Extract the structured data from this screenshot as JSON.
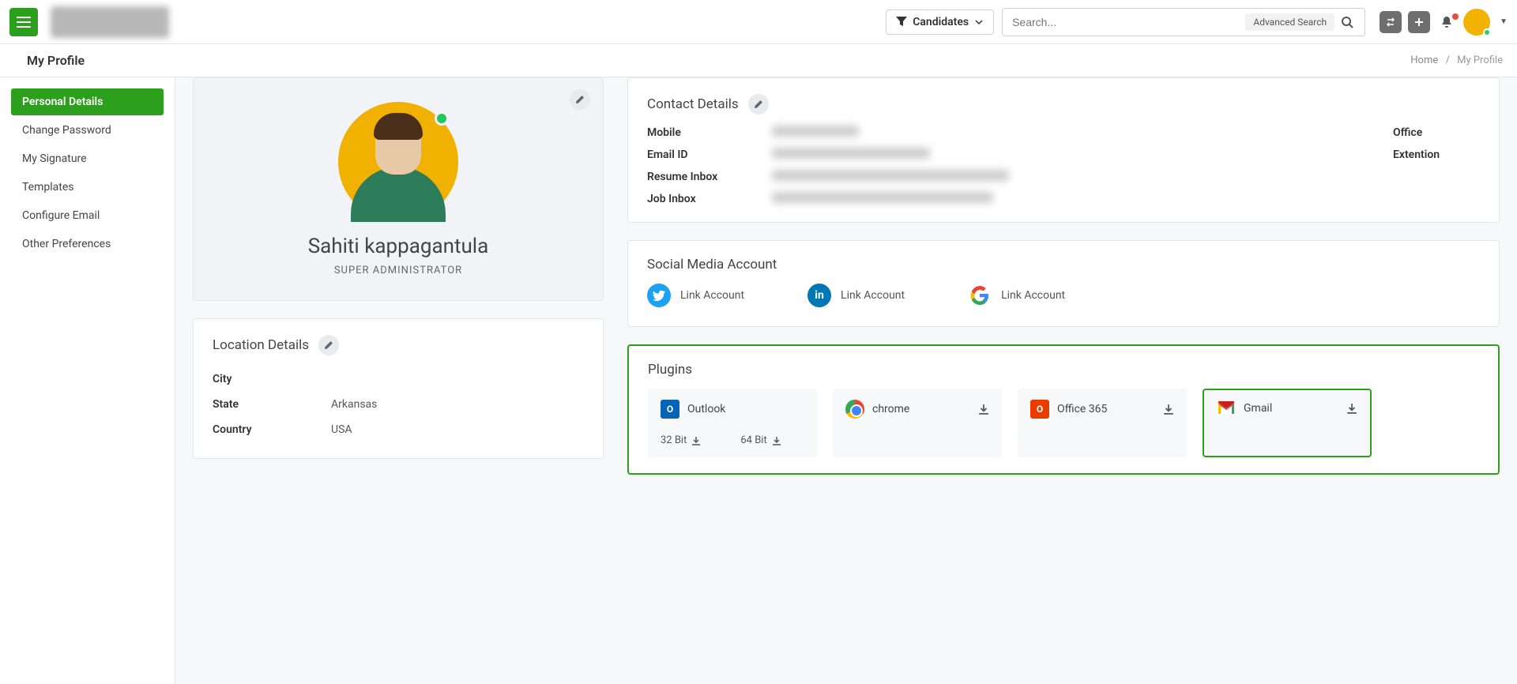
{
  "header": {
    "filter_label": "Candidates",
    "search_placeholder": "Search...",
    "advanced_search": "Advanced Search"
  },
  "subheader": {
    "title": "My Profile",
    "breadcrumb_home": "Home",
    "breadcrumb_current": "My Profile"
  },
  "sidebar": {
    "items": [
      "Personal Details",
      "Change Password",
      "My Signature",
      "Templates",
      "Configure Email",
      "Other Preferences"
    ]
  },
  "profile": {
    "name": "Sahiti kappagantula",
    "role": "SUPER ADMINISTRATOR"
  },
  "location": {
    "title": "Location Details",
    "city_label": "City",
    "city_value": "",
    "state_label": "State",
    "state_value": "Arkansas",
    "country_label": "Country",
    "country_value": "USA"
  },
  "contact": {
    "title": "Contact Details",
    "mobile_label": "Mobile",
    "office_label": "Office",
    "email_label": "Email ID",
    "ext_label": "Extention",
    "resume_label": "Resume Inbox",
    "job_label": "Job Inbox"
  },
  "social": {
    "title": "Social Media Account",
    "link_text": "Link Account"
  },
  "plugins": {
    "title": "Plugins",
    "outlook": "Outlook",
    "bit32": "32 Bit",
    "bit64": "64 Bit",
    "chrome": "chrome",
    "office365": "Office 365",
    "gmail": "Gmail"
  }
}
